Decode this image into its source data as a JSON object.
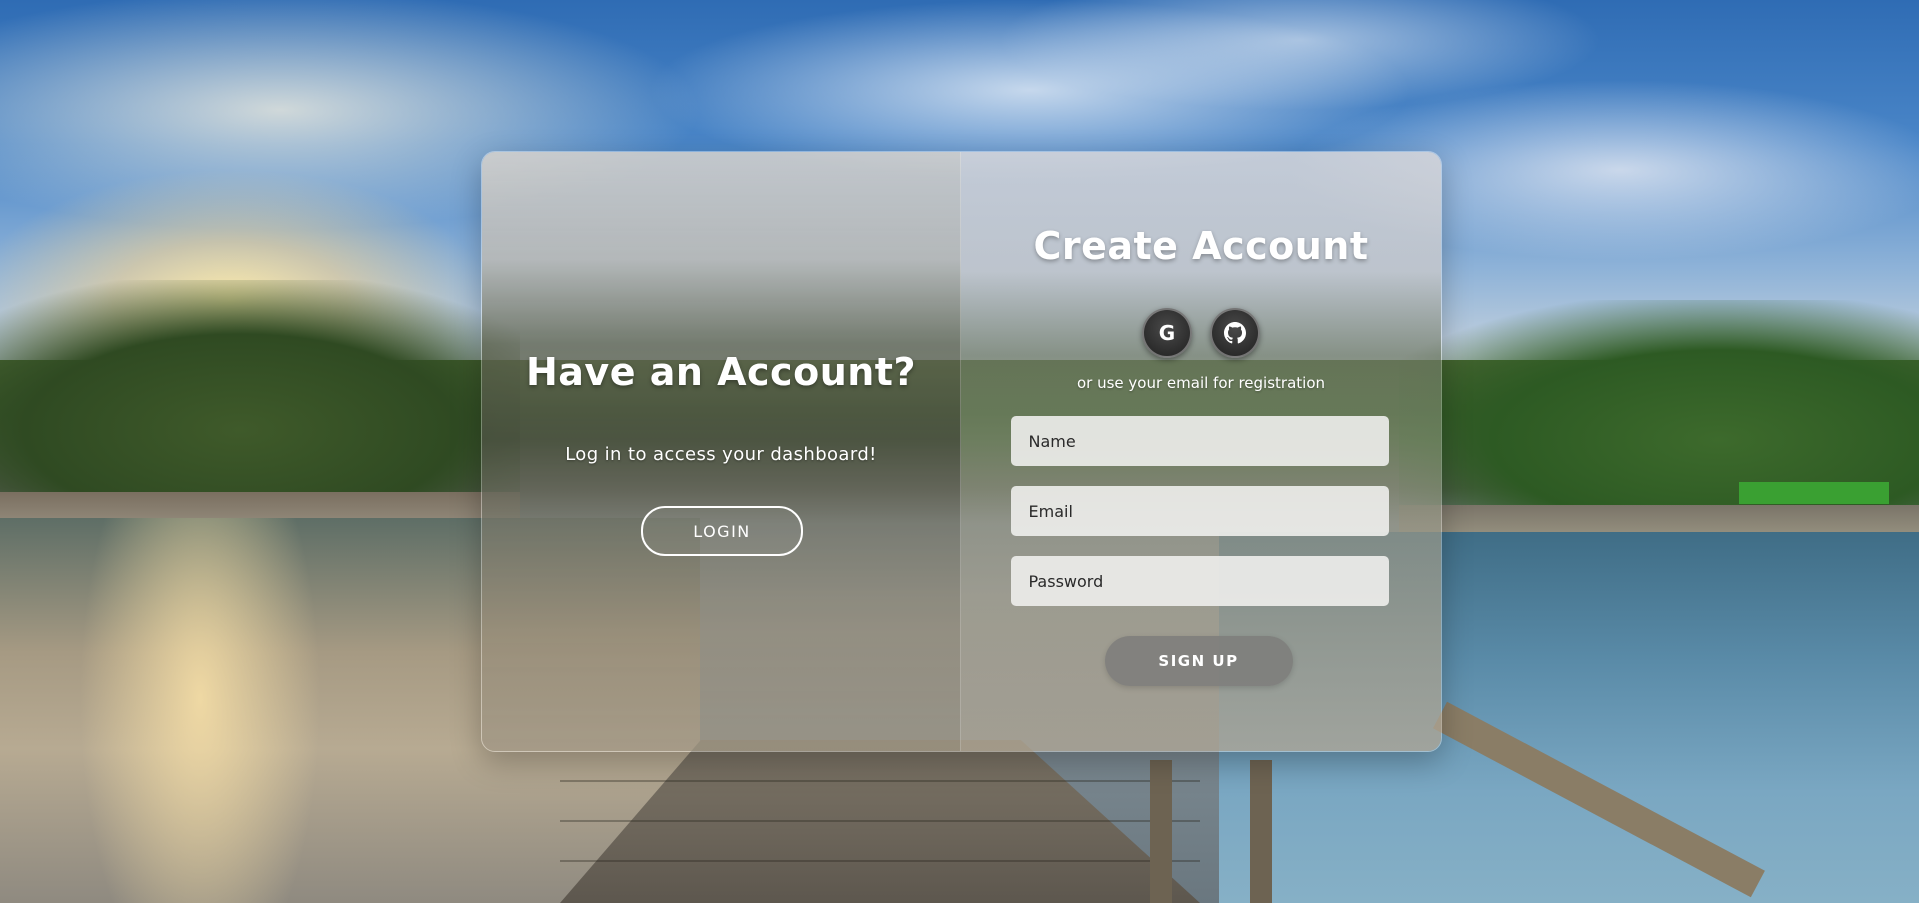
{
  "login_panel": {
    "title": "Have an Account?",
    "subtitle": "Log in to access your dashboard!",
    "login_label": "LOGIN"
  },
  "signup_panel": {
    "title": "Create Account",
    "social": [
      {
        "name": "google",
        "glyph": "G",
        "icon": "google-icon"
      },
      {
        "name": "github",
        "glyph": "⊙",
        "icon": "github-icon"
      }
    ],
    "divider_text": "or use your email for registration",
    "fields": {
      "name_placeholder": "Name",
      "email_placeholder": "Email",
      "password_placeholder": "Password"
    },
    "signup_label": "SIGN UP"
  },
  "colors": {
    "button_text": "#ffffff",
    "signup_button_bg": "#7d7d7a",
    "social_button_bg": "#2a2a2a"
  }
}
